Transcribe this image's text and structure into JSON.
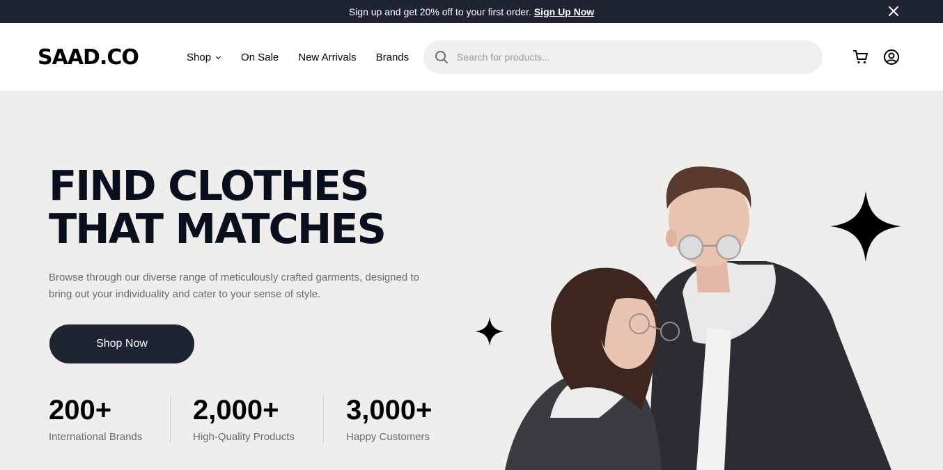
{
  "promo": {
    "text": "Sign up and get 20% off to your first order.",
    "link_label": "Sign Up Now",
    "close_icon": "close-icon"
  },
  "header": {
    "logo": "SAAD.CO",
    "nav": {
      "shop": "Shop",
      "on_sale": "On Sale",
      "new_arrivals": "New Arrivals",
      "brands": "Brands"
    },
    "search": {
      "placeholder": "Search for products...",
      "value": "",
      "icon": "search-icon"
    },
    "icons": [
      "cart-icon",
      "account-icon"
    ]
  },
  "hero": {
    "title_line1": "FIND CLOTHES",
    "title_line2": "THAT MATCHES",
    "description": "Browse through our diverse range of meticulously crafted garments, designed to bring out your individuality and cater to your sense of style.",
    "cta_label": "Shop Now",
    "stats": [
      {
        "number": "200+",
        "label": "International Brands"
      },
      {
        "number": "2,000+",
        "label": "High-Quality Products"
      },
      {
        "number": "3,000+",
        "label": "Happy Customers"
      }
    ]
  },
  "colors": {
    "dark": "#1f2433",
    "background": "#f0eeed",
    "text_muted": "#6b6b6b"
  }
}
